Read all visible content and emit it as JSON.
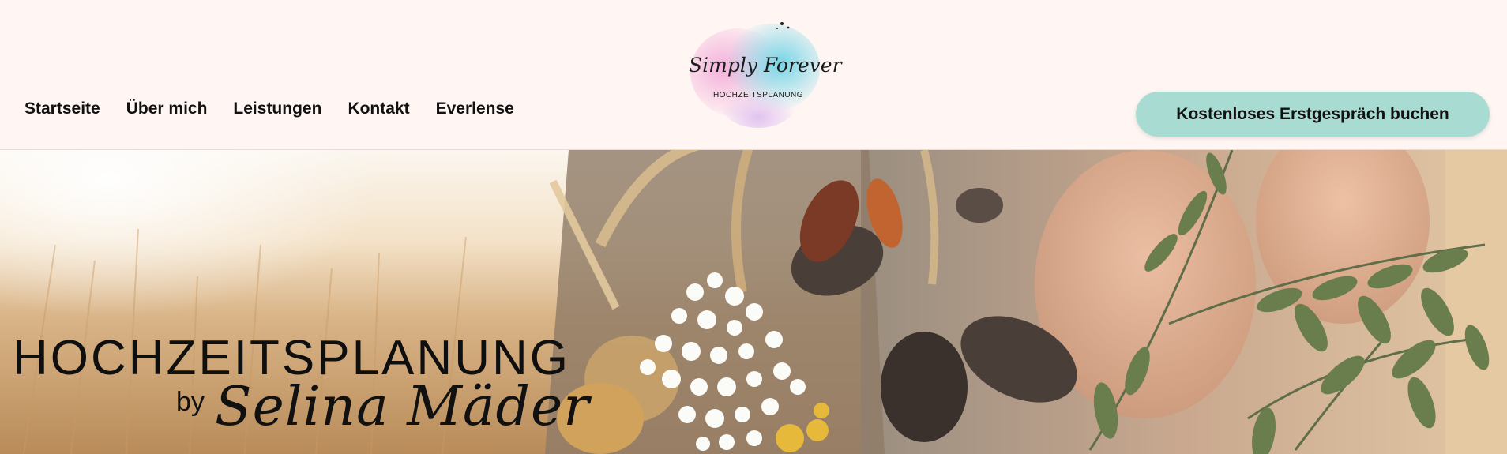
{
  "nav": {
    "items": [
      {
        "label": "Startseite"
      },
      {
        "label": "Über mich"
      },
      {
        "label": "Leistungen"
      },
      {
        "label": "Kontakt"
      },
      {
        "label": "Everlense"
      }
    ]
  },
  "logo": {
    "script_text": "Simply Forever",
    "subtitle": "HOCHZEITSPLANUNG"
  },
  "cta": {
    "label": "Kostenloses Erstgespräch buchen",
    "color": "#a8dcd2"
  },
  "hero": {
    "title": "HOCHZEITSPLANUNG",
    "by": "by",
    "name": "Selina Mäder"
  },
  "colors": {
    "background": "#fff6f3",
    "accent": "#a8dcd2"
  }
}
